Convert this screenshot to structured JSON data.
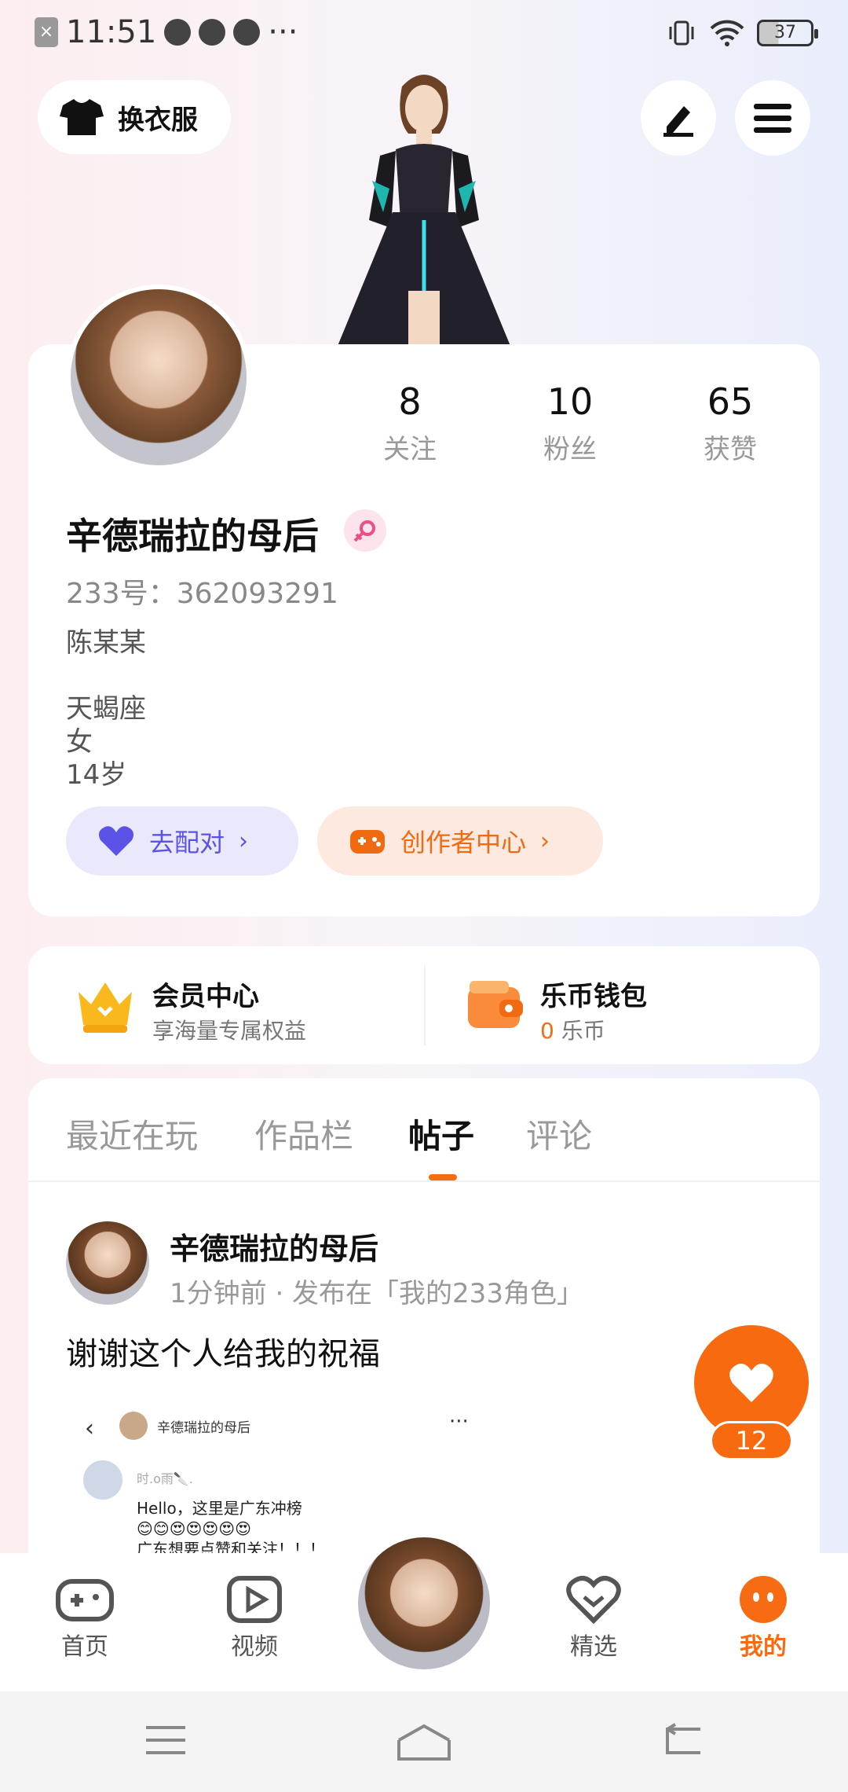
{
  "status_bar": {
    "time": "11:51",
    "battery": "37"
  },
  "top": {
    "dress_label": "换衣服"
  },
  "profile": {
    "stats": [
      {
        "num": "8",
        "label": "关注"
      },
      {
        "num": "10",
        "label": "粉丝"
      },
      {
        "num": "65",
        "label": "获赞"
      }
    ],
    "nickname": "辛德瑞拉的母后",
    "uid": "233号：362093291",
    "realname": "陈某某",
    "zodiac": "天蝎座",
    "gender": "女",
    "age": "14岁",
    "match_label": "去配对",
    "creator_label": "创作者中心"
  },
  "member": {
    "title": "会员中心",
    "subtitle": "享海量专属权益"
  },
  "wallet": {
    "title": "乐币钱包",
    "amount": "0",
    "unit": "乐币"
  },
  "tabs": [
    "最近在玩",
    "作品栏",
    "帖子",
    "评论"
  ],
  "post": {
    "author": "辛德瑞拉的母后",
    "meta": "1分钟前 · 发布在「我的233角色」",
    "text": "谢谢这个人给我的祝福",
    "image": {
      "header_name": "辛德瑞拉的母后",
      "commenter": "时.o雨🔪.",
      "line1": "Hello，这里是广东冲榜",
      "line2": "😊😊😍😍😍😍😍",
      "line3": "广东想要点赞和关注！！！"
    }
  },
  "like": {
    "count": "12"
  },
  "nav": {
    "home": "首页",
    "video": "视频",
    "featured": "精选",
    "mine": "我的"
  },
  "colors": {
    "accent": "#f76b12",
    "match": "#5b52e6"
  }
}
